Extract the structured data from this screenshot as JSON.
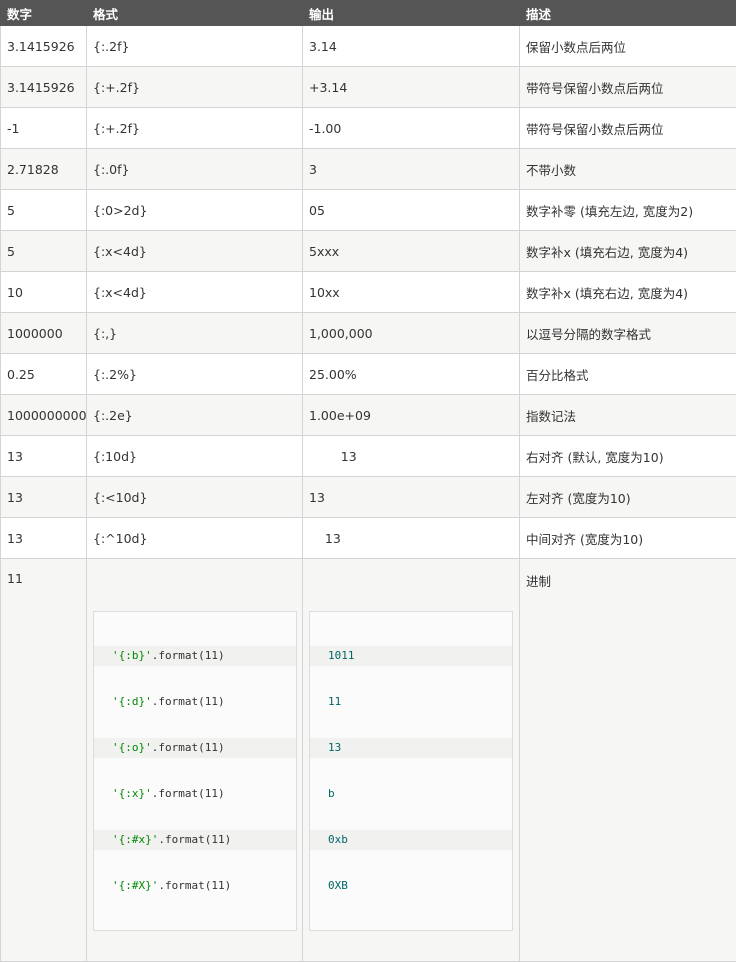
{
  "headers": [
    "数字",
    "格式",
    "输出",
    "描述"
  ],
  "rows": [
    {
      "num": "3.1415926",
      "fmt": "{:.2f}",
      "out": "3.14",
      "desc": "保留小数点后两位"
    },
    {
      "num": "3.1415926",
      "fmt": "{:+.2f}",
      "out": "+3.14",
      "desc": "带符号保留小数点后两位"
    },
    {
      "num": "-1",
      "fmt": "{:+.2f}",
      "out": "-1.00",
      "desc": "带符号保留小数点后两位"
    },
    {
      "num": "2.71828",
      "fmt": "{:.0f}",
      "out": "3",
      "desc": "不带小数"
    },
    {
      "num": "5",
      "fmt": "{:0>2d}",
      "out": "05",
      "desc": "数字补零 (填充左边, 宽度为2)"
    },
    {
      "num": "5",
      "fmt": "{:x<4d}",
      "out": "5xxx",
      "desc": "数字补x (填充右边, 宽度为4)"
    },
    {
      "num": "10",
      "fmt": "{:x<4d}",
      "out": "10xx",
      "desc": "数字补x (填充右边, 宽度为4)"
    },
    {
      "num": "1000000",
      "fmt": "{:,}",
      "out": "1,000,000",
      "desc": "以逗号分隔的数字格式"
    },
    {
      "num": "0.25",
      "fmt": "{:.2%}",
      "out": "25.00%",
      "desc": "百分比格式"
    },
    {
      "num": "1000000000",
      "fmt": "{:.2e}",
      "out": "1.00e+09",
      "desc": "指数记法"
    },
    {
      "num": "13",
      "fmt": "{:10d}",
      "out": "        13",
      "desc": "右对齐 (默认, 宽度为10)"
    },
    {
      "num": "13",
      "fmt": "{:<10d}",
      "out": "13",
      "desc": "左对齐 (宽度为10)"
    },
    {
      "num": "13",
      "fmt": "{:^10d}",
      "out": "    13",
      "desc": "中间对齐 (宽度为10)"
    }
  ],
  "last_row": {
    "num": "11",
    "desc": "进制",
    "code_lines": [
      {
        "str": "'{:b}'",
        "rest": ".format(11)"
      },
      {
        "str": "'{:d}'",
        "rest": ".format(11)"
      },
      {
        "str": "'{:o}'",
        "rest": ".format(11)"
      },
      {
        "str": "'{:x}'",
        "rest": ".format(11)"
      },
      {
        "str": "'{:#x}'",
        "rest": ".format(11)"
      },
      {
        "str": "'{:#X}'",
        "rest": ".format(11)"
      }
    ],
    "outputs": [
      "1011",
      "11",
      "13",
      "b",
      "0xb",
      "0XB"
    ]
  }
}
